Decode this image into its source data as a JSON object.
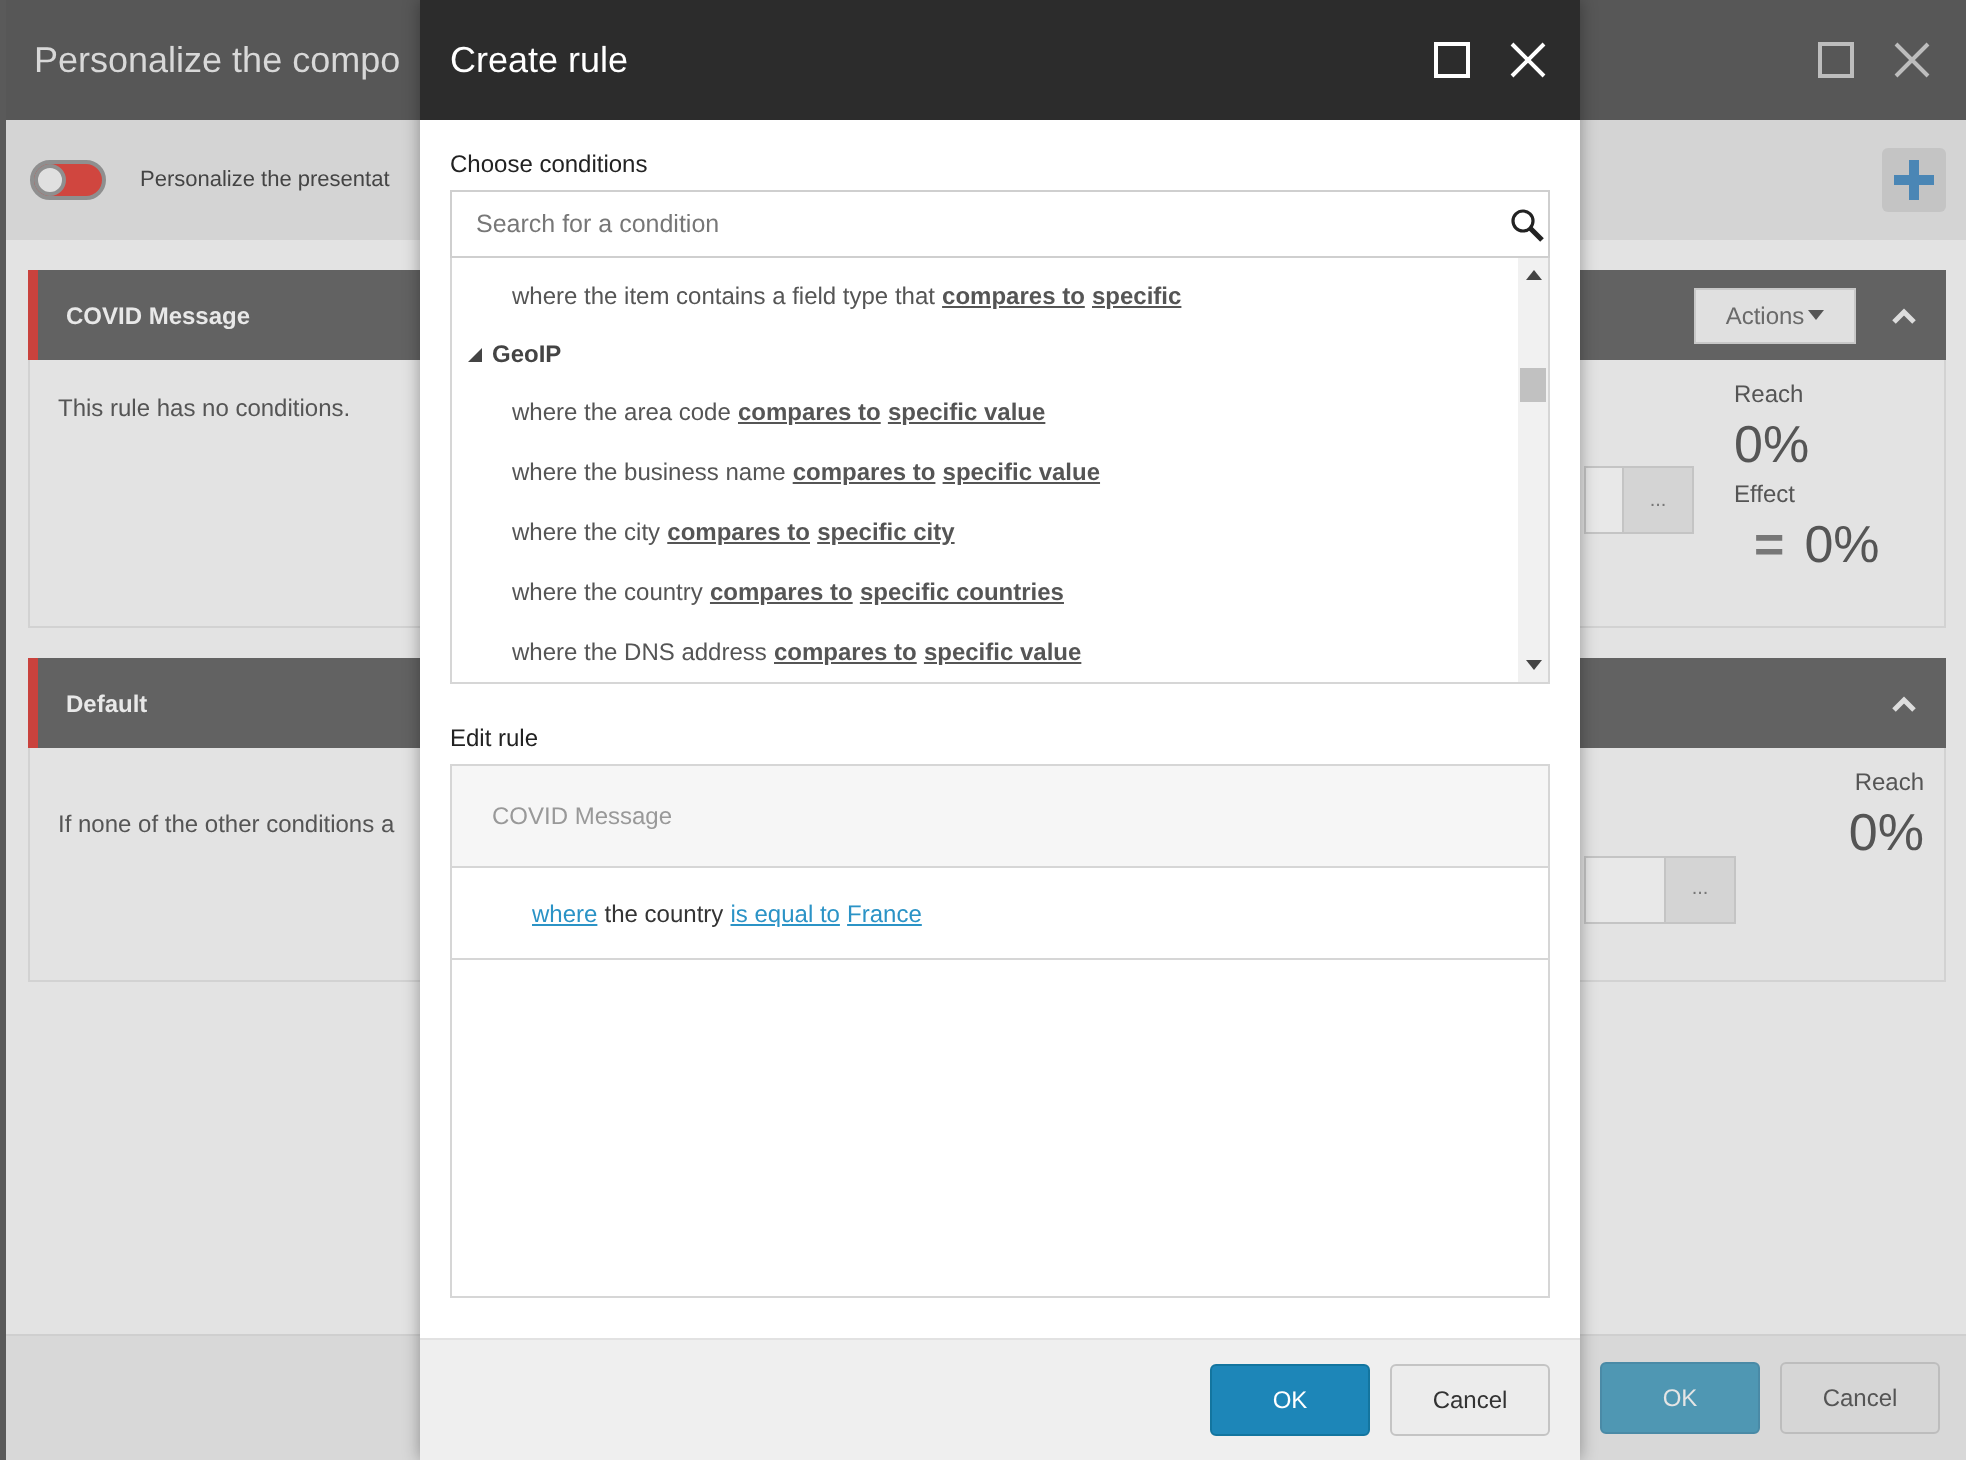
{
  "window": {
    "title": "Personalize the compo"
  },
  "toolbar": {
    "toggle": {
      "on": false
    },
    "label": "Personalize the presentat"
  },
  "rules": [
    {
      "name": "COVID Message",
      "actions": "Actions",
      "description": "This rule has no conditions.",
      "browse": "...",
      "stats": [
        {
          "label": "Reach",
          "value": "0%"
        },
        {
          "label": "Effect",
          "sign": "=",
          "value": "0%"
        }
      ]
    },
    {
      "name": "Default",
      "description": "If none of the other conditions a",
      "browse": "...",
      "stats": [
        {
          "label": "Reach",
          "value": "0%"
        }
      ]
    }
  ],
  "buttons": [
    {
      "label": "OK",
      "kind": "primary"
    },
    {
      "label": "Cancel",
      "kind": "secondary"
    }
  ],
  "dialog": {
    "title": "Create rule",
    "conditions_label": "Choose conditions",
    "search": {
      "placeholder": "Search for a condition"
    },
    "conditions": [
      {
        "kind": "condition",
        "segments": [
          {
            "kind": "text",
            "text": "where the item contains a field type that"
          },
          {
            "kind": "link",
            "text": "compares to"
          },
          {
            "kind": "link",
            "text": "specific"
          }
        ]
      },
      {
        "kind": "group",
        "label": "GeoIP",
        "expanded": true,
        "children": [
          {
            "kind": "condition",
            "segments": [
              {
                "kind": "text",
                "text": "where the area code"
              },
              {
                "kind": "link",
                "text": "compares to"
              },
              {
                "kind": "link",
                "text": "specific value"
              }
            ]
          },
          {
            "kind": "condition",
            "segments": [
              {
                "kind": "text",
                "text": "where the business name"
              },
              {
                "kind": "link",
                "text": "compares to"
              },
              {
                "kind": "link",
                "text": "specific value"
              }
            ]
          },
          {
            "kind": "condition",
            "segments": [
              {
                "kind": "text",
                "text": "where the city"
              },
              {
                "kind": "link",
                "text": "compares to"
              },
              {
                "kind": "link",
                "text": "specific city"
              }
            ]
          },
          {
            "kind": "condition",
            "segments": [
              {
                "kind": "text",
                "text": "where the country"
              },
              {
                "kind": "link",
                "text": "compares to"
              },
              {
                "kind": "link",
                "text": "specific countries"
              }
            ]
          },
          {
            "kind": "condition",
            "segments": [
              {
                "kind": "text",
                "text": "where the DNS address"
              },
              {
                "kind": "link",
                "text": "compares to"
              },
              {
                "kind": "link",
                "text": "specific value"
              }
            ]
          }
        ]
      }
    ],
    "edit_label": "Edit rule",
    "rule_name": "COVID Message",
    "rule_lines": [
      {
        "segments": [
          {
            "kind": "link",
            "text": "where"
          },
          {
            "kind": "text",
            "text": "the country"
          },
          {
            "kind": "link",
            "text": "is equal to"
          },
          {
            "kind": "link",
            "text": "France"
          }
        ]
      }
    ],
    "buttons": [
      {
        "label": "OK",
        "kind": "primary"
      },
      {
        "label": "Cancel",
        "kind": "secondary"
      }
    ]
  }
}
